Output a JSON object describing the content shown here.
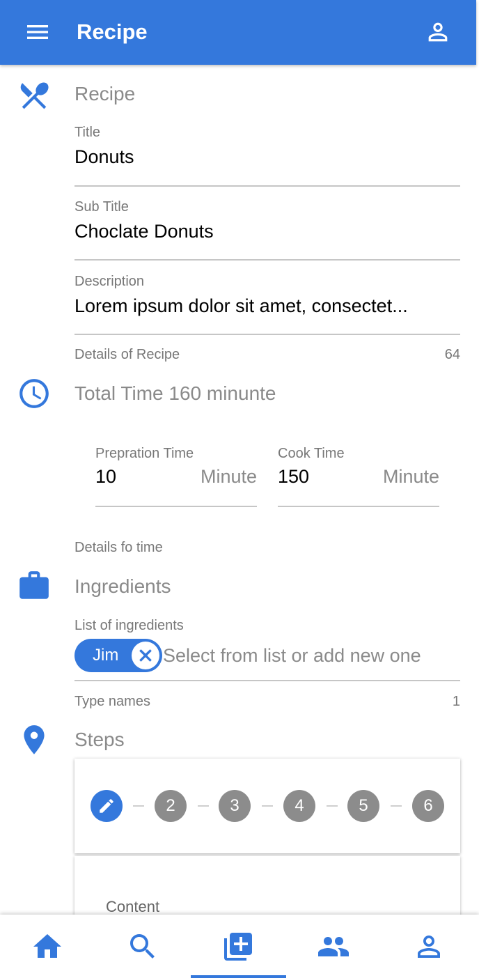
{
  "app_bar": {
    "title": "Recipe",
    "menu_icon": "menu-icon",
    "account_icon": "account-icon"
  },
  "recipe_section": {
    "icon": "restaurant-icon",
    "title": "Recipe",
    "title_field": {
      "label": "Title",
      "value": "Donuts"
    },
    "subtitle_field": {
      "label": "Sub Title",
      "value": "Choclate Donuts"
    },
    "description_field": {
      "label": "Description",
      "value": "Lorem ipsum dolor sit amet, consectet..."
    },
    "helper": "Details of Recipe",
    "counter": "64"
  },
  "time_section": {
    "icon": "clock-icon",
    "title": "Total Time 160 minunte",
    "prep": {
      "label": "Prepration Time",
      "value": "10",
      "suffix": "Minute"
    },
    "cook": {
      "label": "Cook Time",
      "value": "150",
      "suffix": "Minute"
    },
    "helper": "Details fo time"
  },
  "ingredients_section": {
    "icon": "briefcase-icon",
    "title": "Ingredients",
    "label": "List of ingredients",
    "chips": [
      "Jim"
    ],
    "placeholder": "Select from list or add new one",
    "helper": "Type names",
    "counter": "1"
  },
  "steps_section": {
    "icon": "location-pin-icon",
    "title": "Steps",
    "steps": [
      "2",
      "3",
      "4",
      "5",
      "6"
    ],
    "active_step_icon": "pencil-icon",
    "content_label": "Content"
  },
  "bottom_nav": {
    "items": [
      "home-icon",
      "search-icon",
      "add-box-icon",
      "group-icon",
      "account-icon"
    ],
    "active_index": 2
  },
  "colors": {
    "primary": "#3478dc",
    "step_inactive": "#8c8c8c",
    "muted_text": "#8a8a8a"
  }
}
